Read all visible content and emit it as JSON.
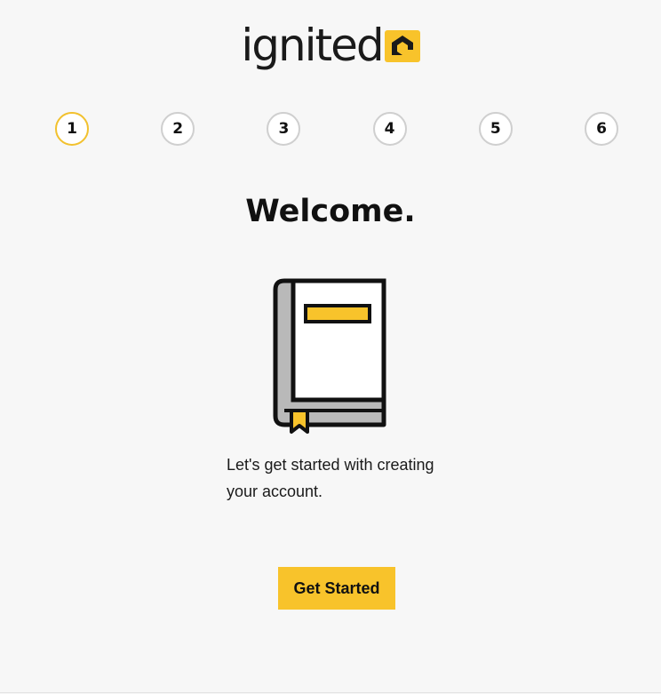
{
  "brand": {
    "name": "ignited",
    "accent": "#f8c32b"
  },
  "steps": [
    {
      "label": "1",
      "active": true
    },
    {
      "label": "2",
      "active": false
    },
    {
      "label": "3",
      "active": false
    },
    {
      "label": "4",
      "active": false
    },
    {
      "label": "5",
      "active": false
    },
    {
      "label": "6",
      "active": false
    }
  ],
  "main": {
    "title": "Welcome.",
    "illustration": "book-icon",
    "intro": "Let's get started with creating your account.",
    "cta_label": "Get Started"
  }
}
